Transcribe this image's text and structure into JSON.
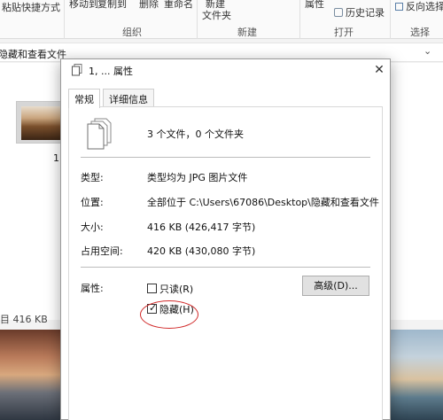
{
  "ribbon": {
    "paste_shortcut": "粘贴快捷方式",
    "move_to": "移动到",
    "copy_to": "复制到",
    "delete": "删除",
    "rename": "重命名",
    "new": "新建",
    "new_folder": "文件夹",
    "properties": "属性",
    "history": "历史记录",
    "invert_selection": "反向选择",
    "groups": {
      "organize": "组织",
      "new": "新建",
      "open": "打开",
      "select": "选择"
    }
  },
  "address_path": "隐藏和查看文件",
  "file_label": "1",
  "status_text": "目 416 KB",
  "dialog": {
    "title": "1, ... 属性",
    "close_glyph": "✕",
    "tabs": [
      "常规",
      "详细信息"
    ],
    "summary": "3 个文件，0 个文件夹",
    "rows": [
      {
        "label": "类型:",
        "value": "类型均为 JPG 图片文件"
      },
      {
        "label": "位置:",
        "value": "全部位于 C:\\Users\\67086\\Desktop\\隐藏和查看文件"
      },
      {
        "label": "大小:",
        "value": "416 KB (426,417 字节)"
      },
      {
        "label": "占用空间:",
        "value": "420 KB (430,080 字节)"
      }
    ],
    "attributes_label": "属性:",
    "readonly_label": "只读(R)",
    "readonly_checked": false,
    "hidden_label": "隐藏(H)",
    "hidden_checked": true,
    "check_glyph": "✓",
    "advanced_label": "高级(D)...",
    "annotation_color": "#d12a2a"
  }
}
